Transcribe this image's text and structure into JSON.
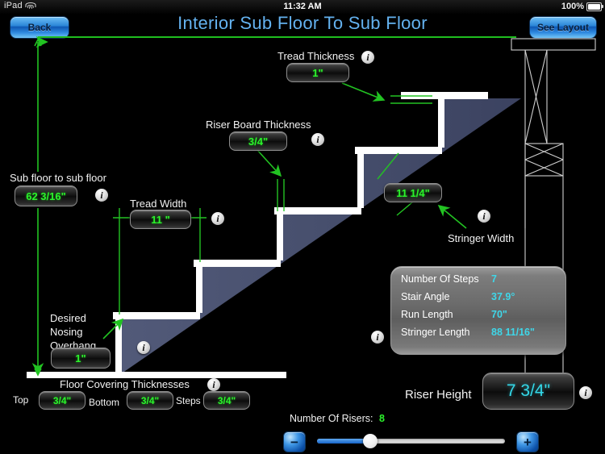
{
  "statusbar": {
    "carrier": "iPad",
    "wifi_icon": "wifi-icon",
    "time": "11:32 AM",
    "battery_percent": "100%",
    "battery_icon": "battery-full-icon"
  },
  "nav": {
    "back_label": "Back",
    "see_layout_label": "See Layout",
    "title": "Interior Sub Floor To Sub Floor"
  },
  "fields": {
    "sub_floor": {
      "label": "Sub floor to sub floor",
      "value": "62 3/16\""
    },
    "tread_thickness": {
      "label": "Tread Thickness",
      "value": "1\""
    },
    "riser_board_thickness": {
      "label": "Riser Board Thickness",
      "value": "3/4\""
    },
    "tread_width": {
      "label": "Tread Width",
      "value": "11 \""
    },
    "stringer_width": {
      "label": "Stringer Width",
      "value": "11 1/4\""
    },
    "nosing_overhang": {
      "label_line1": "Desired",
      "label_line2": "Nosing",
      "label_line3": "Overhang",
      "value": "1\""
    },
    "floor_covering": {
      "heading": "Floor Covering Thicknesses",
      "top_label": "Top",
      "top_value": "3/4\"",
      "bottom_label": "Bottom",
      "bottom_value": "3/4\"",
      "steps_label": "Steps",
      "steps_value": "3/4\""
    },
    "riser_height": {
      "label": "Riser Height",
      "value": "7 3/4\""
    },
    "number_of_risers": {
      "label": "Number Of Risers:",
      "value": "8"
    }
  },
  "results": {
    "rows": [
      {
        "key": "Number Of Steps",
        "value": "7"
      },
      {
        "key": "Stair Angle",
        "value": "37.9°"
      },
      {
        "key": "Run Length",
        "value": "70\""
      },
      {
        "key": "Stringer Length",
        "value": "88 11/16\""
      }
    ]
  },
  "controls": {
    "minus_label": "−",
    "plus_label": "+",
    "slider_value_percent": 28
  },
  "icons": {
    "info": "i"
  },
  "colors": {
    "title_blue": "#64b2f0",
    "value_green": "#2bf32b",
    "value_cyan": "#34d8e8",
    "dimension_green": "#22c322",
    "stringer_fill": "#4c5472",
    "tread_white": "#ffffff"
  }
}
